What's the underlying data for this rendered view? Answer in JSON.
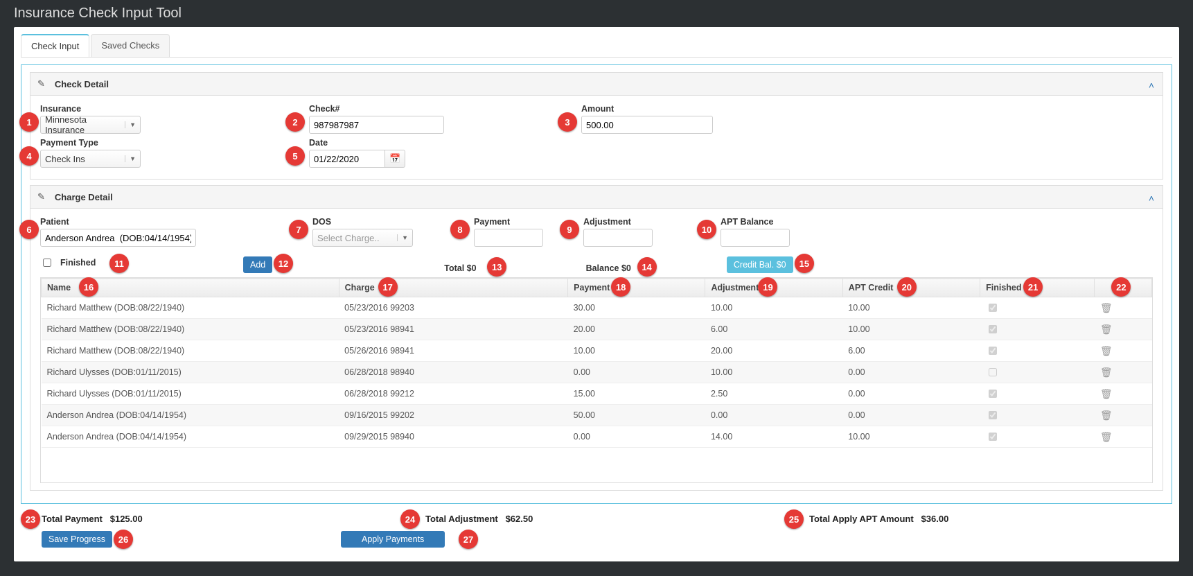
{
  "window": {
    "title": "Insurance Check Input Tool"
  },
  "tabs": {
    "active": "Check Input",
    "other": "Saved Checks"
  },
  "sections": {
    "checkDetail": "Check Detail",
    "chargeDetail": "Charge Detail"
  },
  "checkDetail": {
    "insurance": {
      "label": "Insurance",
      "value": "Minnesota Insurance"
    },
    "checkNum": {
      "label": "Check#",
      "value": "987987987"
    },
    "amount": {
      "label": "Amount",
      "value": "500.00"
    },
    "paymentType": {
      "label": "Payment Type",
      "value": "Check Ins"
    },
    "date": {
      "label": "Date",
      "value": "01/22/2020"
    }
  },
  "chargeDetail": {
    "patient": {
      "label": "Patient",
      "value": "Anderson Andrea  (DOB:04/14/1954)"
    },
    "dos": {
      "label": "DOS",
      "placeholder": "Select Charge.."
    },
    "payment": {
      "label": "Payment",
      "value": ""
    },
    "adjustment": {
      "label": "Adjustment",
      "value": ""
    },
    "aptBalance": {
      "label": "APT Balance",
      "value": ""
    },
    "finishedLabel": "Finished",
    "addLabel": "Add",
    "total": "Total $0",
    "balance": "Balance $0",
    "creditBal": "Credit Bal. $0"
  },
  "table": {
    "headers": {
      "name": "Name",
      "charge": "Charge",
      "payment": "Payment",
      "adjustment": "Adjustment",
      "aptcredit": "APT Credit",
      "finished": "Finished"
    },
    "rows": [
      {
        "name": "Richard Matthew (DOB:08/22/1940)",
        "charge": "05/23/2016 99203",
        "payment": "30.00",
        "adjustment": "10.00",
        "apt": "10.00",
        "finished": true
      },
      {
        "name": "Richard Matthew (DOB:08/22/1940)",
        "charge": "05/23/2016 98941",
        "payment": "20.00",
        "adjustment": "6.00",
        "apt": "10.00",
        "finished": true
      },
      {
        "name": "Richard Matthew (DOB:08/22/1940)",
        "charge": "05/26/2016 98941",
        "payment": "10.00",
        "adjustment": "20.00",
        "apt": "6.00",
        "finished": true
      },
      {
        "name": "Richard Ulysses (DOB:01/11/2015)",
        "charge": "06/28/2018 98940",
        "payment": "0.00",
        "adjustment": "10.00",
        "apt": "0.00",
        "finished": false
      },
      {
        "name": "Richard Ulysses (DOB:01/11/2015)",
        "charge": "06/28/2018 99212",
        "payment": "15.00",
        "adjustment": "2.50",
        "apt": "0.00",
        "finished": true
      },
      {
        "name": "Anderson Andrea (DOB:04/14/1954)",
        "charge": "09/16/2015 99202",
        "payment": "50.00",
        "adjustment": "0.00",
        "apt": "0.00",
        "finished": true
      },
      {
        "name": "Anderson Andrea (DOB:04/14/1954)",
        "charge": "09/29/2015 98940",
        "payment": "0.00",
        "adjustment": "14.00",
        "apt": "10.00",
        "finished": true
      }
    ]
  },
  "totals": {
    "payment": {
      "label": "Total Payment",
      "value": "$125.00"
    },
    "adjustment": {
      "label": "Total Adjustment",
      "value": "$62.50"
    },
    "apt": {
      "label": "Total Apply APT Amount",
      "value": "$36.00"
    }
  },
  "buttons": {
    "save": "Save Progress",
    "apply": "Apply Payments"
  },
  "markers": [
    "1",
    "2",
    "3",
    "4",
    "5",
    "6",
    "7",
    "8",
    "9",
    "10",
    "11",
    "12",
    "13",
    "14",
    "15",
    "16",
    "17",
    "18",
    "19",
    "20",
    "21",
    "22",
    "23",
    "24",
    "25",
    "26",
    "27"
  ]
}
